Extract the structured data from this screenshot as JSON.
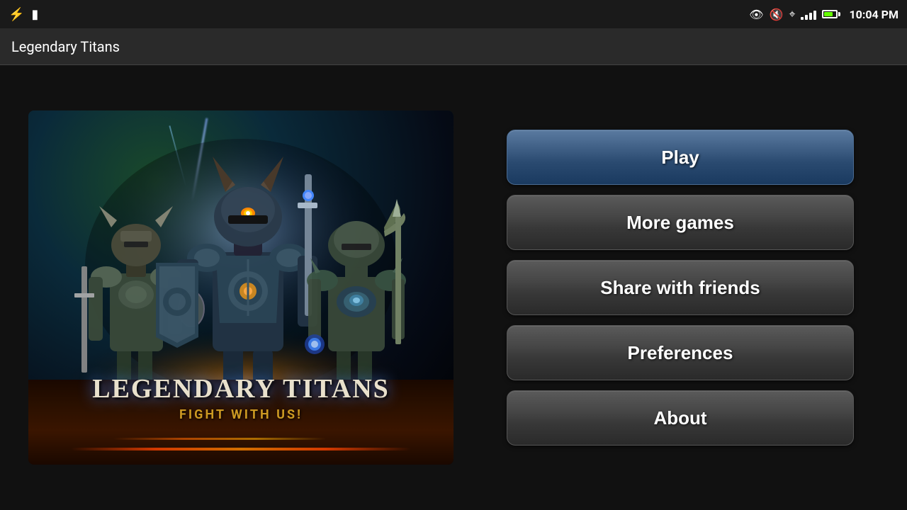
{
  "statusBar": {
    "time": "10:04 PM",
    "leftIcons": [
      "usb-icon",
      "sim-icon"
    ],
    "rightIcons": [
      "eye-icon",
      "mute-icon",
      "wifi-icon",
      "signal-icon",
      "battery-icon"
    ]
  },
  "titleBar": {
    "title": "Legendary Titans"
  },
  "gameImage": {
    "titleMain": "LEGENDARY TITANS",
    "titleSub": "FIGHT WITH US!"
  },
  "menu": {
    "buttons": [
      {
        "id": "play",
        "label": "Play"
      },
      {
        "id": "more-games",
        "label": "More games"
      },
      {
        "id": "share",
        "label": "Share with friends"
      },
      {
        "id": "preferences",
        "label": "Preferences"
      },
      {
        "id": "about",
        "label": "About"
      }
    ]
  }
}
